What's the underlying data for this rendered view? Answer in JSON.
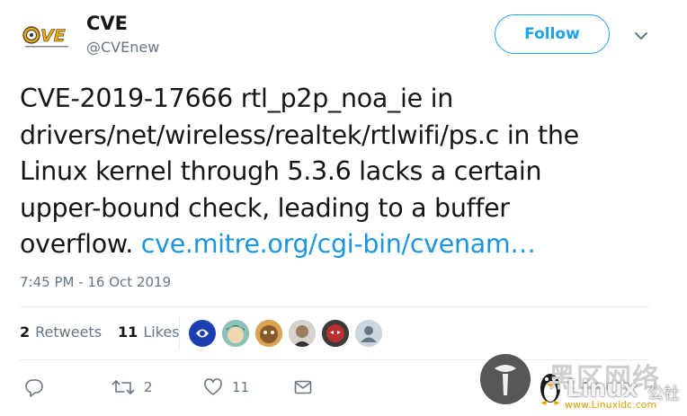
{
  "header": {
    "display_name": "CVE",
    "handle": "@CVEnew",
    "follow_label": "Follow",
    "avatar_logo_text": "CVE"
  },
  "tweet": {
    "text_lines": [
      "CVE-2019-17666 rtl_p2p_noa_ie in",
      "drivers/net/wireless/realtek/rtlwifi/ps.c in the",
      "Linux kernel through 5.3.6 lacks a certain",
      "upper-bound check, leading to a buffer",
      "overflow."
    ],
    "link_text": "cve.mitre.org/cgi-bin/cvenam…",
    "timestamp": "7:45 PM - 16 Oct 2019"
  },
  "stats": {
    "retweets_count": "2",
    "retweets_label": "Retweets",
    "likes_count": "11",
    "likes_label": "Likes"
  },
  "actions": {
    "reply_icon": "reply-icon",
    "retweet_count": "2",
    "like_count": "11",
    "dm_icon": "envelope-icon"
  },
  "watermark": {
    "cn_text": "黑区网络",
    "brand": "Linux",
    "site": "www.Linuxidc.com",
    "suffix": "公社"
  },
  "colors": {
    "accent": "#1da1f2",
    "link": "#1b95e0",
    "text": "#14171a",
    "muted": "#657786"
  }
}
